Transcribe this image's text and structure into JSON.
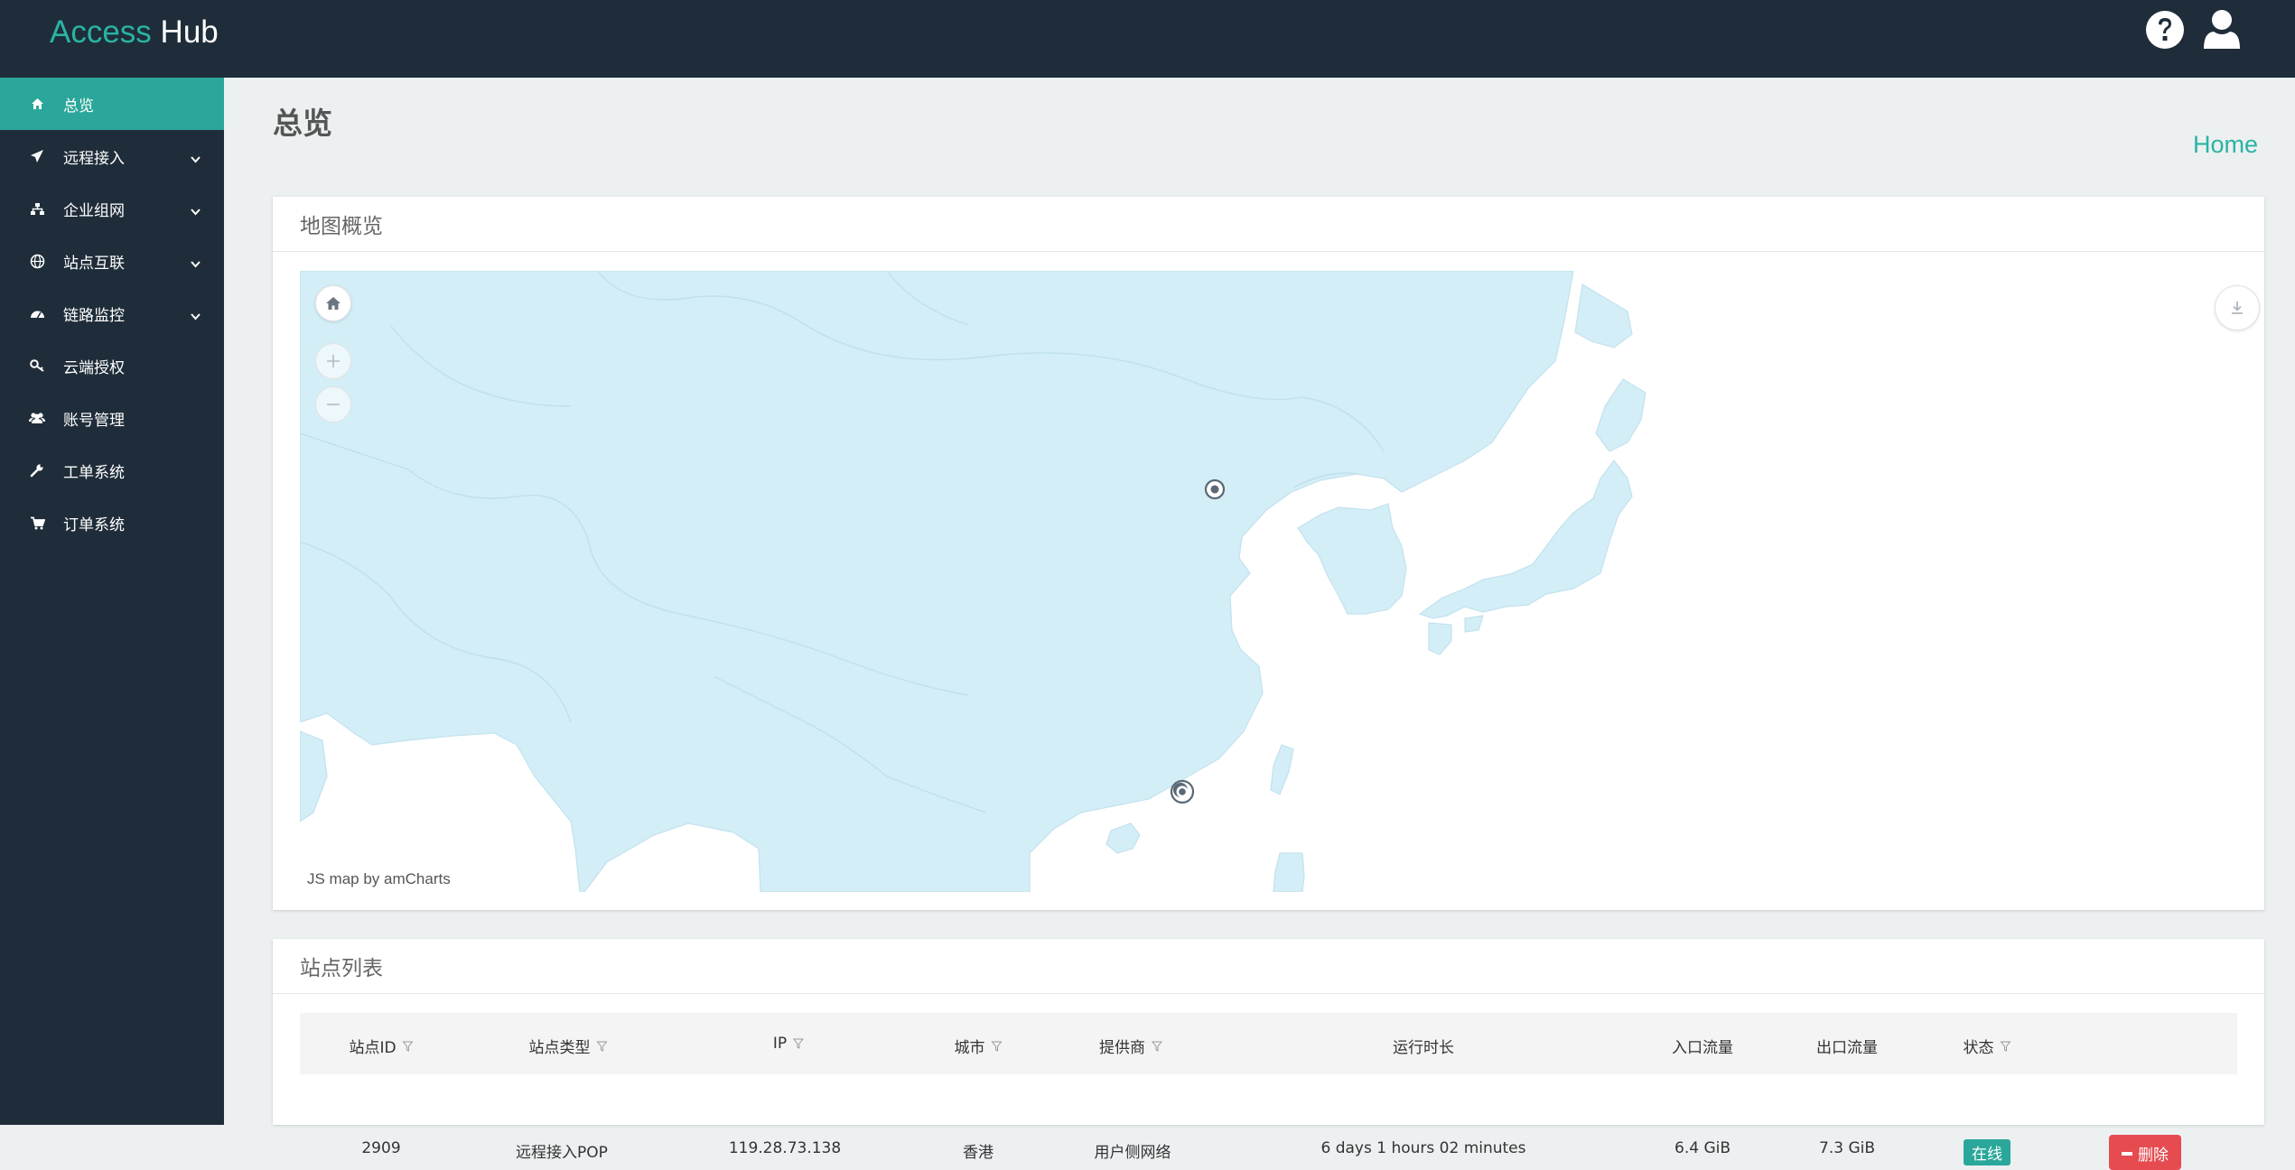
{
  "app": {
    "brand_part1": "Access",
    "brand_part2": "Hub"
  },
  "header": {
    "help_icon": "question-circle-icon",
    "user_icon": "user-icon"
  },
  "sidebar": {
    "items": [
      {
        "label": "总览",
        "icon": "home-icon",
        "active": true,
        "has_submenu": false
      },
      {
        "label": "远程接入",
        "icon": "plane-icon",
        "active": false,
        "has_submenu": true
      },
      {
        "label": "企业组网",
        "icon": "sitemap-icon",
        "active": false,
        "has_submenu": true
      },
      {
        "label": "站点互联",
        "icon": "globe-icon",
        "active": false,
        "has_submenu": true
      },
      {
        "label": "链路监控",
        "icon": "dashboard-icon",
        "active": false,
        "has_submenu": true
      },
      {
        "label": "云端授权",
        "icon": "key-icon",
        "active": false,
        "has_submenu": false
      },
      {
        "label": "账号管理",
        "icon": "users-icon",
        "active": false,
        "has_submenu": false
      },
      {
        "label": "工单系统",
        "icon": "wrench-icon",
        "active": false,
        "has_submenu": false
      },
      {
        "label": "订单系统",
        "icon": "cart-icon",
        "active": false,
        "has_submenu": false
      }
    ]
  },
  "page": {
    "title": "总览",
    "breadcrumb": "Home"
  },
  "map_panel": {
    "title": "地图概览",
    "credit": "JS map by amCharts",
    "land_color": "#d3eef7"
  },
  "sites_panel": {
    "title": "站点列表",
    "columns": [
      {
        "label": "站点ID",
        "filter": true
      },
      {
        "label": "站点类型",
        "filter": true
      },
      {
        "label": "IP",
        "filter": true
      },
      {
        "label": "城市",
        "filter": true
      },
      {
        "label": "提供商",
        "filter": true
      },
      {
        "label": "运行时长",
        "filter": false
      },
      {
        "label": "入口流量",
        "filter": false
      },
      {
        "label": "出口流量",
        "filter": false
      },
      {
        "label": "状态",
        "filter": true
      }
    ],
    "rows": [
      {
        "id": "2909",
        "type": "远程接入POP",
        "ip": "119.28.73.138",
        "city": "香港",
        "provider": "用户侧网络",
        "uptime": "6 days 1 hours 02 minutes",
        "in": "6.4 GiB",
        "out": "7.3 GiB",
        "status": "在线",
        "action": "删除"
      }
    ]
  },
  "colors": {
    "accent": "#2aa79a",
    "header_bg": "#1f2d3a",
    "danger": "#e54b4f"
  }
}
